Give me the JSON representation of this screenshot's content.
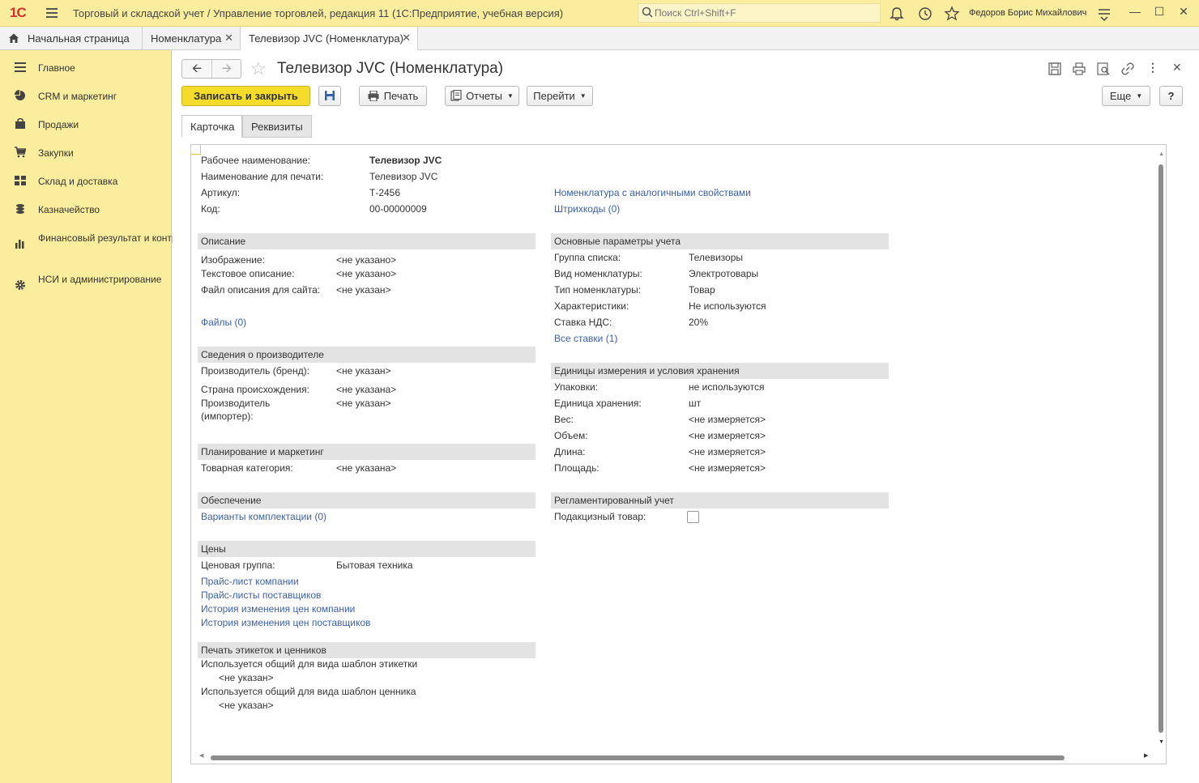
{
  "titlebar": {
    "logo": "1С",
    "app_title": "Торговый и складской учет / Управление торговлей, редакция 11  (1С:Предприятие, учебная версия)",
    "search_placeholder": "Поиск Ctrl+Shift+F",
    "user": "Федоров Борис Михайлович"
  },
  "tabs": [
    {
      "label": "Начальная страница"
    },
    {
      "label": "Номенклатура"
    },
    {
      "label": "Телевизор JVC (Номенклатура)"
    }
  ],
  "sidebar": {
    "items": [
      {
        "label": "Главное",
        "icon": "menu-lines-icon"
      },
      {
        "label": "CRM и маркетинг",
        "icon": "pie-chart-icon"
      },
      {
        "label": "Продажи",
        "icon": "bag-icon"
      },
      {
        "label": "Закупки",
        "icon": "cart-icon"
      },
      {
        "label": "Склад и доставка",
        "icon": "grid-icon"
      },
      {
        "label": "Казначейство",
        "icon": "coins-icon"
      },
      {
        "label": "Финансовый результат и контроллинг",
        "icon": "bar-chart-icon"
      },
      {
        "label": "НСИ и администрирование",
        "icon": "gear-icon"
      }
    ]
  },
  "form": {
    "title": "Телевизор JVC (Номенклатура)",
    "buttons": {
      "save_close": "Записать и закрыть",
      "print": "Печать",
      "reports": "Отчеты",
      "goto": "Перейти",
      "more": "Еще",
      "help": "?"
    },
    "tabs": [
      "Карточка",
      "Реквизиты"
    ],
    "header_fields": {
      "work_name_label": "Рабочее наименование:",
      "work_name": "Телевизор JVC",
      "print_name_label": "Наименование для печати:",
      "print_name": "Телевизор JVC",
      "article_label": "Артикул:",
      "article": "Т-2456",
      "code_label": "Код:",
      "code": "00-00000009",
      "similar_link": "Номенклатура с аналогичными свойствами",
      "barcodes_link": "Штрихкоды (0)"
    },
    "description": {
      "title": "Описание",
      "image_label": "Изображение:",
      "image": "<не указано>",
      "text_label": "Текстовое описание:",
      "text": "<не указано>",
      "file_label": "Файл описания для сайта:",
      "file": "<не указан>",
      "files_link": "Файлы (0)"
    },
    "manufacturer": {
      "title": "Сведения о производителе",
      "brand_label": "Производитель (бренд):",
      "brand": "<не указан>",
      "country_label": "Страна происхождения:",
      "country": "<не указана>",
      "importer_label_1": "Производитель",
      "importer_label_2": "(импортер):",
      "importer": "<не указан>"
    },
    "planning": {
      "title": "Планирование и маркетинг",
      "category_label": "Товарная категория:",
      "category": "<не указана>"
    },
    "supply": {
      "title": "Обеспечение",
      "kits_link": "Варианты комплектации (0)"
    },
    "prices": {
      "title": "Цены",
      "group_label": "Ценовая группа:",
      "group": "Бытовая техника",
      "links": [
        "Прайс-лист компании",
        "Прайс-листы поставщиков",
        "История изменения цен компании",
        "История изменения цен поставщиков"
      ]
    },
    "labels": {
      "title": "Печать этикеток и ценников",
      "label_template": "Используется общий для вида шаблон этикетки",
      "label_value": "<не указан>",
      "tag_template": "Используется общий для вида шаблон ценника",
      "tag_value": "<не указан>"
    },
    "accounting": {
      "title": "Основные параметры учета",
      "group_label": "Группа списка:",
      "group": "Телевизоры",
      "kind_label": "Вид номенклатуры:",
      "kind": "Электротовары",
      "type_label": "Тип номенклатуры:",
      "type": "Товар",
      "chars_label": "Характеристики:",
      "chars": "Не используются",
      "vat_label": "Ставка НДС:",
      "vat": "20%",
      "all_rates_link": "Все ставки (1)"
    },
    "units": {
      "title": "Единицы измерения и условия хранения",
      "packs_label": "Упаковки:",
      "packs": "не используются",
      "unit_label": "Единица хранения:",
      "unit": "шт",
      "weight_label": "Вес:",
      "weight": "<не измеряется>",
      "volume_label": "Объем:",
      "volume": "<не измеряется>",
      "length_label": "Длина:",
      "length": "<не измеряется>",
      "area_label": "Площадь:",
      "area": "<не измеряется>"
    },
    "regulated": {
      "title": "Регламентированный учет",
      "excise_label": "Подакцизный товар:",
      "excise_checked": false
    }
  }
}
